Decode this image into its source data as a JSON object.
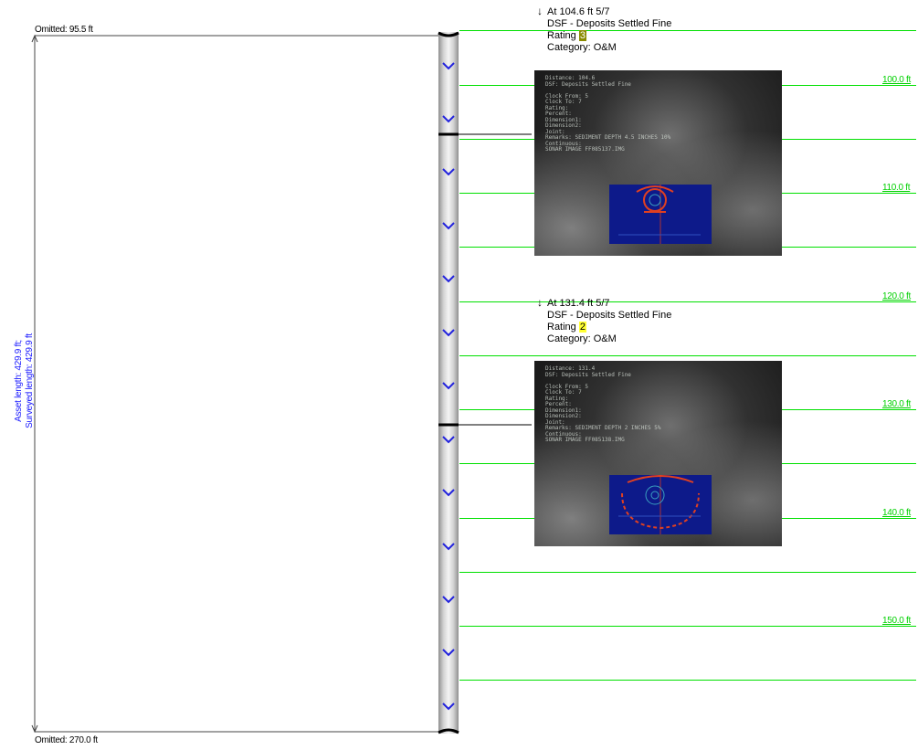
{
  "omitted_top": "Omitted: 95.5 ft",
  "omitted_bottom": "Omitted: 270.0 ft",
  "asset_length": "Asset length: 429.9 ft;",
  "surveyed_length": "Surveyed length: 429.9 ft",
  "distance_marks": [
    "100.0 ft",
    "110.0 ft",
    "120.0 ft",
    "130.0 ft",
    "140.0 ft",
    "150.0 ft"
  ],
  "observations": [
    {
      "at": "At 104.6 ft 5/7",
      "code": "DSF - Deposits Settled Fine",
      "rating_label": "Rating",
      "rating": "3",
      "rating_color": "#8a8a00",
      "category": "Category: O&M",
      "osd_text": "Distance: 104.6\nDSF: Deposits Settled Fine\n\nClock From: 5\nClock To: 7\nRating:\nPercent:\nDimension1:\nDimension2:\nJoint:\nRemarks: SEDIMENT DEPTH 4.5 INCHES 10%\nContinuous:\nSONAR IMAGE FF085137.IMG"
    },
    {
      "at": "At 131.4 ft 5/7",
      "code": "DSF - Deposits Settled Fine",
      "rating_label": "Rating",
      "rating": "2",
      "rating_color": "#ffff33",
      "category": "Category: O&M",
      "osd_text": "Distance: 131.4\nDSF: Deposits Settled Fine\n\nClock From: 5\nClock To: 7\nRating:\nPercent:\nDimension1:\nDimension2:\nJoint:\nRemarks: SEDIMENT DEPTH 2 INCHES 5%\nContinuous:\nSONAR IMAGE FF085138.IMG"
    }
  ],
  "colors": {
    "distance_line": "#00e000",
    "side_label": "#1c1cff",
    "chevron": "#2222dd"
  }
}
